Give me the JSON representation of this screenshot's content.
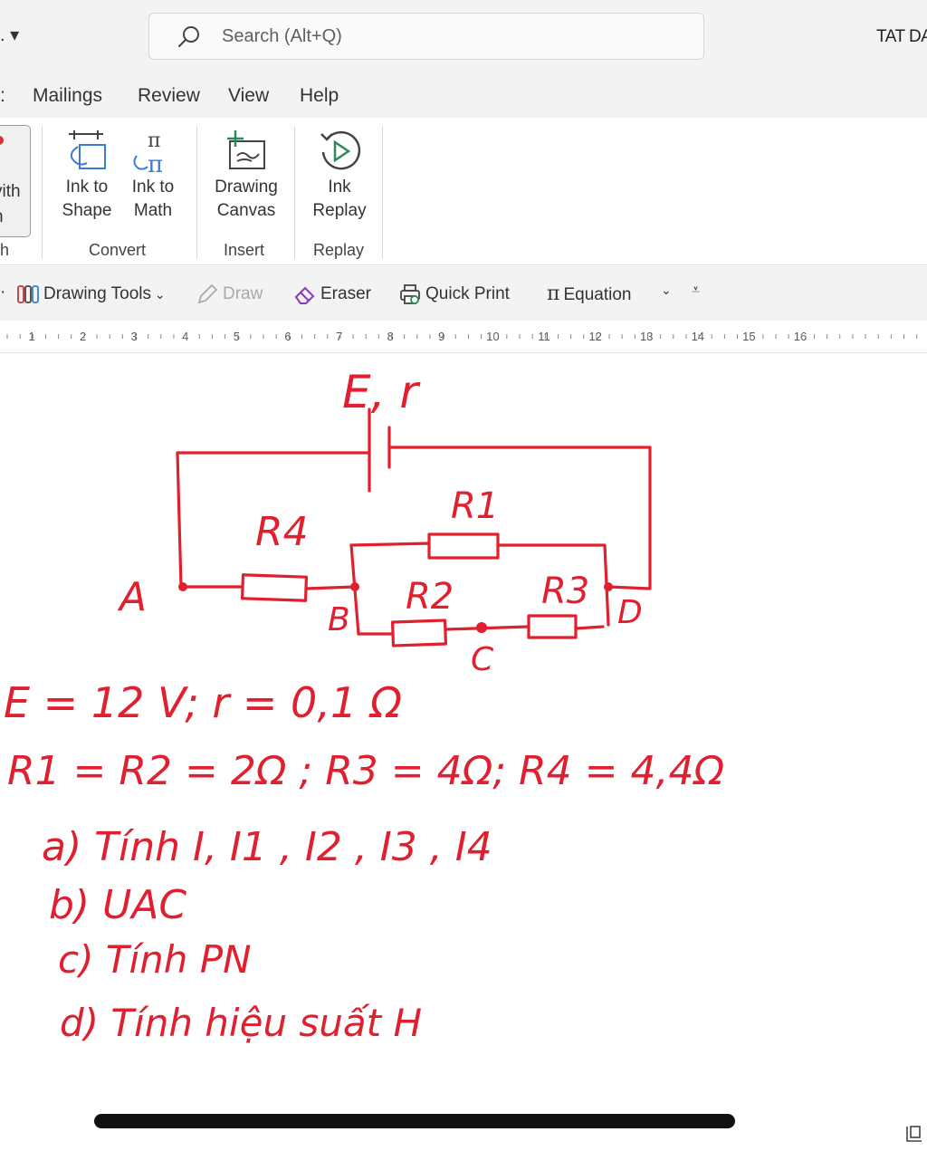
{
  "titlebar": {
    "qa_dropdown": ". ▾",
    "search_placeholder": "Search (Alt+Q)",
    "user_name": "TAT DA"
  },
  "tabs": [
    "Mailings",
    "Review",
    "View",
    "Help"
  ],
  "ribbon": {
    "partial_button_label_1": "vith",
    "partial_button_label_2": "h",
    "partial_group_label": "h",
    "buttons": {
      "ink_to_shape": [
        "Ink to",
        "Shape"
      ],
      "ink_to_math": [
        "Ink to",
        "Math"
      ],
      "drawing_canvas": [
        "Drawing",
        "Canvas"
      ],
      "ink_replay": [
        "Ink",
        "Replay"
      ]
    },
    "groups": {
      "convert": "Convert",
      "insert": "Insert",
      "replay": "Replay"
    }
  },
  "quickbar": {
    "drawing_tools": "Drawing Tools",
    "draw": "Draw",
    "eraser": "Eraser",
    "quick_print": "Quick Print",
    "equation": "Equation"
  },
  "ruler": {
    "numbers": [
      "1",
      "2",
      "3",
      "4",
      "5",
      "6",
      "7",
      "8",
      "9",
      "10",
      "11",
      "12",
      "13",
      "14",
      "15",
      "16"
    ]
  },
  "ink": {
    "color": "#e0202e",
    "source_label": "E, r",
    "resistors": {
      "r1": "R1",
      "r2": "R2",
      "r3": "R3",
      "r4": "R4"
    },
    "nodes": {
      "a": "A",
      "b": "B",
      "c": "C",
      "d": "D"
    },
    "line1": "E = 12 V;  r =  0,1 Ω",
    "line2": "R1 = R2 =  2Ω   ; R3 = 4Ω; R4 = 4,4Ω",
    "line3": "a) Tính  I, I1 , I2 , I3 , I4",
    "line4": "b)  UAC",
    "line5": "c)  Tính  PN",
    "line6": "d)  Tính hiệu suất  H"
  }
}
